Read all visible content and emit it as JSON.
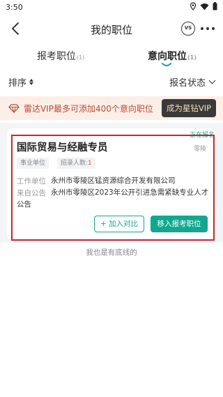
{
  "status_bar": {
    "time": "3:50"
  },
  "nav": {
    "title": "我的职位",
    "vs_label": "VS"
  },
  "tabs": [
    {
      "label": "报考职位",
      "count": "(1)"
    },
    {
      "label": "意向职位",
      "count": "(1)"
    }
  ],
  "filter": {
    "sort_label": "排序",
    "status_label": "报名状态"
  },
  "vip_banner": {
    "text": "雷达VIP最多可添加400个意向职位",
    "button": "成为星钻VIP"
  },
  "card": {
    "status_badge": "正在报名",
    "title": "国际贸易与经融专员",
    "region": "零陵",
    "tag_unit_type": "事业单位",
    "tag_recruit_label": "招录人数:",
    "tag_recruit_count": "1",
    "work_unit_label": "工作单位",
    "work_unit_value": "永州市零陵区锰资源综合开发有限公司",
    "announcement_label": "来自公告",
    "announcement_value_line1": "永州市零陵区2023年公开引进急需紧缺专业人才",
    "announcement_value_line2": "公告",
    "compare_button": "+ 加入对比",
    "move_button": "移入报考职位"
  },
  "footer_text": "我也是有底线的",
  "colors": {
    "accent": "#12a88f",
    "vip_text": "#b84c35",
    "vip_bg": "#fcefe8",
    "highlight": "#e11b24"
  }
}
